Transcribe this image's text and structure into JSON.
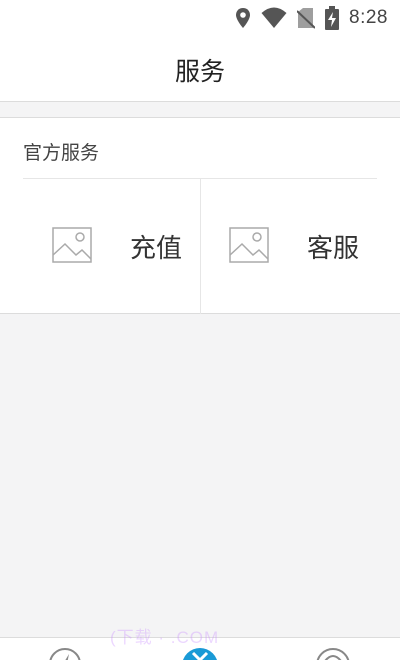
{
  "status_bar": {
    "time": "8:28",
    "icons": [
      "location-icon",
      "wifi-icon",
      "no-sim-icon",
      "battery-charging-icon"
    ]
  },
  "header": {
    "title": "服务"
  },
  "official_services": {
    "title": "官方服务",
    "items": [
      {
        "label": "充值",
        "icon": "image-placeholder-icon"
      },
      {
        "label": "客服",
        "icon": "image-placeholder-icon"
      }
    ]
  },
  "bottom_nav": {
    "icons": [
      "compass-icon",
      "services-icon",
      "profile-icon"
    ],
    "accent_color": "#1a9ad6"
  },
  "watermark": "(下载 · .COM"
}
